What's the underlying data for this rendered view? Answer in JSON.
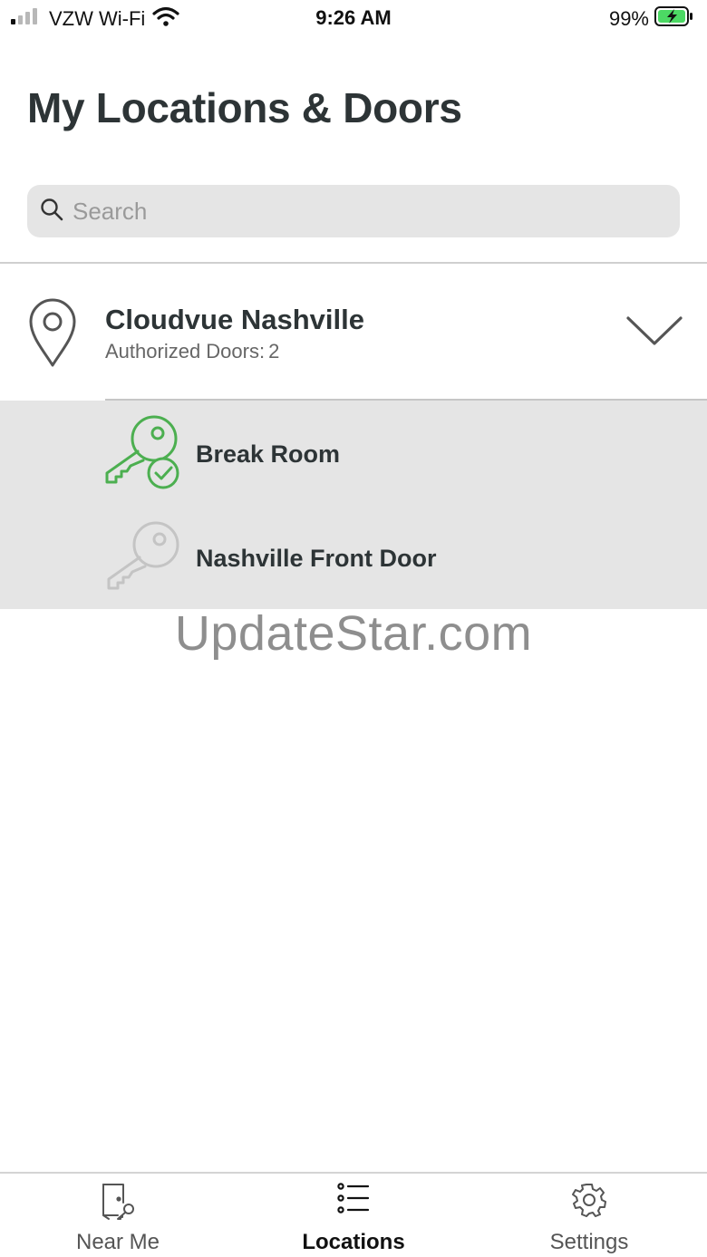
{
  "status_bar": {
    "carrier": "VZW Wi-Fi",
    "time": "9:26 AM",
    "battery": "99%"
  },
  "page": {
    "title": "My Locations & Doors"
  },
  "search": {
    "placeholder": "Search",
    "value": ""
  },
  "location": {
    "name": "Cloudvue Nashville",
    "authorized_label": "Authorized Doors:",
    "authorized_count": "2"
  },
  "doors": [
    {
      "label": "Break Room",
      "status": "authorized",
      "icon": "key-check-icon",
      "color": "#4caf50"
    },
    {
      "label": "Nashville Front Door",
      "status": "unavailable",
      "icon": "key-icon",
      "color": "#c4c4c4"
    }
  ],
  "watermark": "UpdateStar.com",
  "tabs": [
    {
      "label": "Near Me",
      "icon": "door-key-icon",
      "active": false
    },
    {
      "label": "Locations",
      "icon": "list-icon",
      "active": true
    },
    {
      "label": "Settings",
      "icon": "gear-icon",
      "active": false
    }
  ],
  "colors": {
    "accent_green": "#4caf50",
    "text_dark": "#2d3436",
    "panel_gray": "#e5e5e5"
  }
}
